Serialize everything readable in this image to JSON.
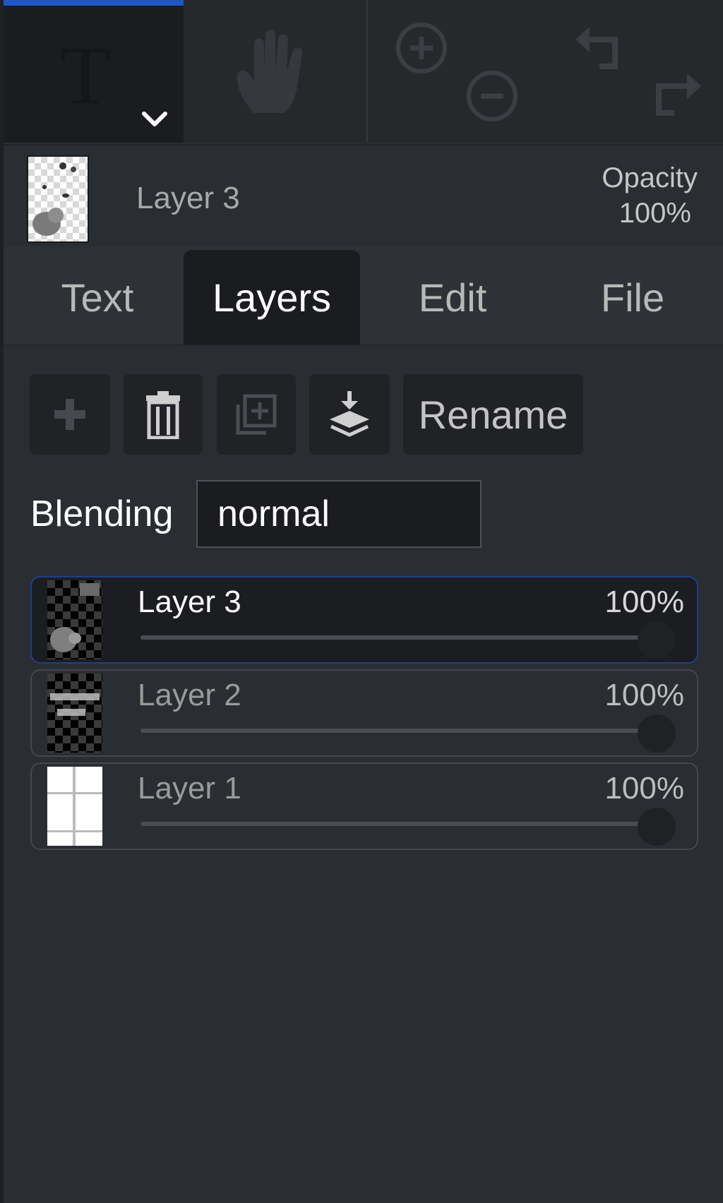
{
  "toolbar": {
    "tools": [
      {
        "name": "text-tool",
        "glyph": "T"
      },
      {
        "name": "hand-tool"
      },
      {
        "name": "zoom-in"
      },
      {
        "name": "zoom-out"
      },
      {
        "name": "undo"
      },
      {
        "name": "redo"
      }
    ]
  },
  "header": {
    "layer_name": "Layer 3",
    "opacity_label": "Opacity",
    "opacity_value": "100%"
  },
  "tabs": [
    {
      "label": "Text",
      "active": false
    },
    {
      "label": "Layers",
      "active": true
    },
    {
      "label": "Edit",
      "active": false
    },
    {
      "label": "File",
      "active": false
    }
  ],
  "layer_actions": {
    "add_icon": "plus-icon",
    "delete_icon": "trash-icon",
    "duplicate_icon": "duplicate-icon",
    "merge_icon": "merge-down-icon",
    "rename_label": "Rename"
  },
  "blending": {
    "label": "Blending",
    "value": "normal"
  },
  "layers": [
    {
      "name": "Layer 3",
      "opacity": "100%",
      "selected": true
    },
    {
      "name": "Layer 2",
      "opacity": "100%",
      "selected": false
    },
    {
      "name": "Layer 1",
      "opacity": "100%",
      "selected": false
    }
  ],
  "colors": {
    "accent": "#1e56c8",
    "background": "#2a2d31",
    "active_tab": "#1b1c1f"
  }
}
